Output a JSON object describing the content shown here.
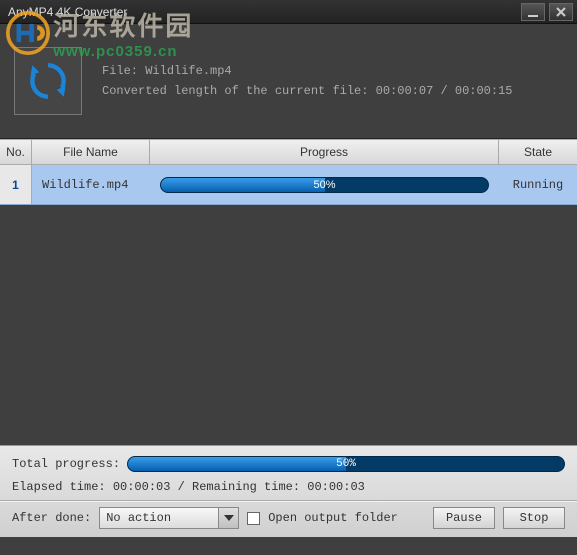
{
  "window": {
    "title": "AnyMP4 4K Converter"
  },
  "watermark": {
    "text": "河东软件园",
    "url": "www.pc0359.cn"
  },
  "current": {
    "file_label": "File: ",
    "file_name": "Wildlife.mp4",
    "length_label": "Converted length of the current file: ",
    "elapsed": "00:00:07",
    "sep": " / ",
    "total": "00:00:15"
  },
  "columns": {
    "no": "No.",
    "name": "File Name",
    "progress": "Progress",
    "state": "State"
  },
  "rows": [
    {
      "no": "1",
      "name": "Wildlife.mp4",
      "percent": 50,
      "percent_label": "50%",
      "state": "Running"
    }
  ],
  "totals": {
    "label": "Total progress:",
    "percent": 50,
    "percent_label": "50%",
    "time_line": "Elapsed time: 00:00:03 / Remaining time: 00:00:03"
  },
  "footer": {
    "after_label": "After done:",
    "after_value": "No action",
    "open_folder_label": "Open output folder",
    "pause": "Pause",
    "stop": "Stop"
  }
}
